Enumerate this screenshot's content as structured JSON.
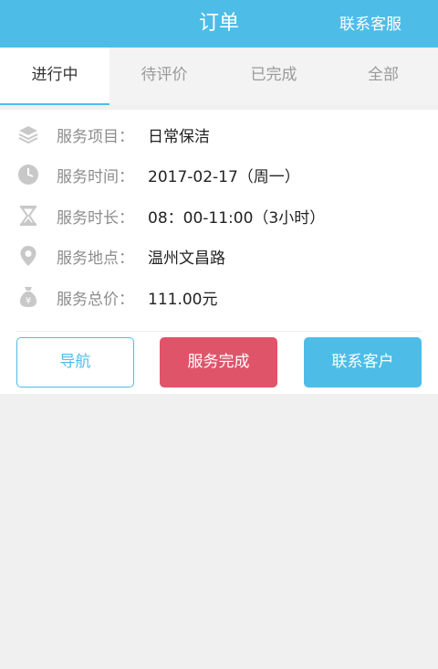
{
  "header": {
    "title": "订单",
    "customer_service": "联系客服"
  },
  "tabs": [
    {
      "label": "进行中",
      "active": true
    },
    {
      "label": "待评价",
      "active": false
    },
    {
      "label": "已完成",
      "active": false
    },
    {
      "label": "全部",
      "active": false
    }
  ],
  "order": {
    "rows": [
      {
        "icon": "layers-icon",
        "label": "服务项目：",
        "value": "日常保洁"
      },
      {
        "icon": "clock-icon",
        "label": "服务时间：",
        "value": "2017-02-17（周一）"
      },
      {
        "icon": "hourglass-icon",
        "label": "服务时长：",
        "value": "08：00-11:00（3小时）"
      },
      {
        "icon": "location-pin-icon",
        "label": "服务地点：",
        "value": "温州文昌路"
      },
      {
        "icon": "money-bag-icon",
        "label": "服务总价：",
        "value": "111.00元"
      }
    ]
  },
  "actions": {
    "navigate": "导航",
    "complete": "服务完成",
    "contact": "联系客户"
  },
  "colors": {
    "accent": "#4dbde8",
    "danger": "#e0546a",
    "icon_gray": "#c8c8c8"
  }
}
